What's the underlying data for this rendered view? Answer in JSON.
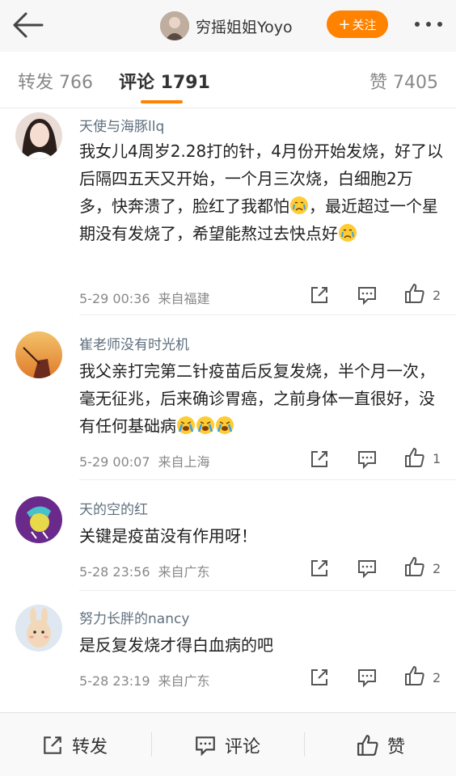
{
  "header": {
    "back_icon": "back-arrow-icon",
    "profile_name": "穷摇姐姐Yoyo",
    "follow_plus": "+",
    "follow_label": "关注",
    "more_icon": "more-dots-icon",
    "accent_color": "#ff8200"
  },
  "tabs": {
    "repost": "转发 766",
    "comment": "评论 1791",
    "like": "赞 7405"
  },
  "comments": [
    {
      "user": "天使与海豚llq",
      "text_parts": [
        "我女儿4周岁2.28打的针，4月份开始发烧，好了以后隔四五天又开始，一个月三次烧，白细胞2万多，快奔溃了，脸红了我都怕",
        "，最近超过一个星期没有发烧了，希望能熬过去快点好"
      ],
      "emojis": [
        "crying-face-emoji",
        "crying-face-emoji"
      ],
      "time": "5-29 00:36",
      "source": "来自福建",
      "likes": "2"
    },
    {
      "user": "崔老师没有时光机",
      "text_parts": [
        "我父亲打完第二针疫苗后反复发烧，半个月一次，毫无征兆，后来确诊胃癌，之前身体一直很好，没有任何基础病"
      ],
      "emojis": [
        "loudly-crying-emoji",
        "loudly-crying-emoji",
        "loudly-crying-emoji"
      ],
      "time": "5-29 00:07",
      "source": "来自上海",
      "likes": "1"
    },
    {
      "user": "天的空的红",
      "text_parts": [
        "关键是疫苗没有作用呀！"
      ],
      "time": "5-28 23:56",
      "source": "来自广东",
      "likes": "2"
    },
    {
      "user": "努力长胖的nancy",
      "text_parts": [
        "是反复发烧才得白血病的吧"
      ],
      "time": "5-28 23:19",
      "source": "来自广东",
      "likes": "2"
    }
  ],
  "bottom_bar": {
    "repost_label": "转发",
    "comment_label": "评论",
    "like_label": "赞"
  }
}
